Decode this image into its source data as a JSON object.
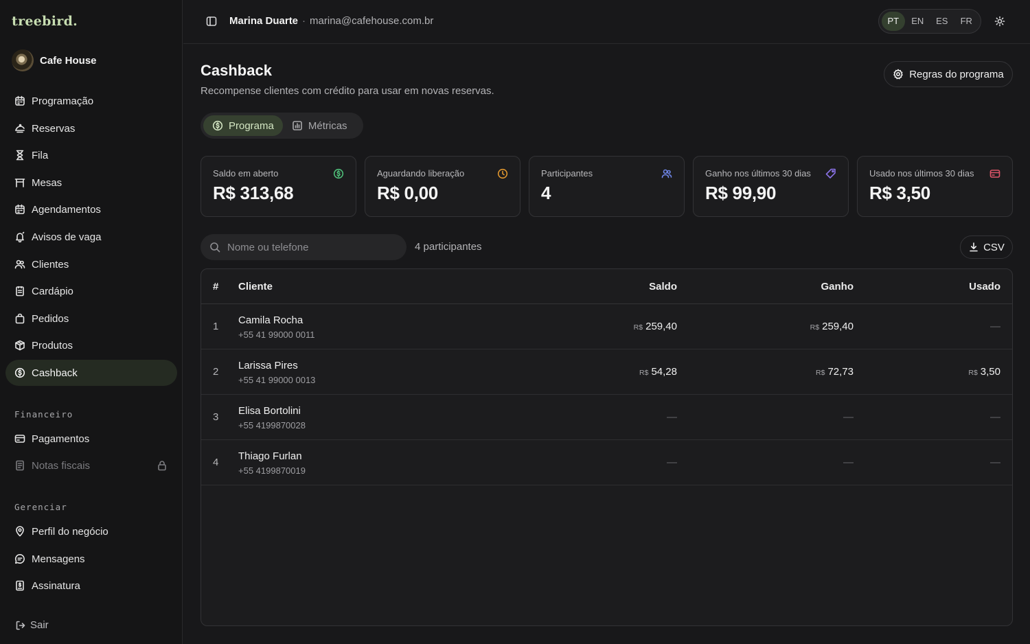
{
  "brand": {
    "logo": "treebird.",
    "business": "Cafe House"
  },
  "sidebar": {
    "items": [
      {
        "label": "Programação",
        "icon": "calendar-icon"
      },
      {
        "label": "Reservas",
        "icon": "reservation-icon"
      },
      {
        "label": "Fila",
        "icon": "hourglass-icon"
      },
      {
        "label": "Mesas",
        "icon": "table-icon"
      },
      {
        "label": "Agendamentos",
        "icon": "calendar-icon"
      },
      {
        "label": "Avisos de vaga",
        "icon": "bell-icon"
      },
      {
        "label": "Clientes",
        "icon": "users-icon"
      },
      {
        "label": "Cardápio",
        "icon": "menu-icon"
      },
      {
        "label": "Pedidos",
        "icon": "bag-icon"
      },
      {
        "label": "Produtos",
        "icon": "package-icon"
      },
      {
        "label": "Cashback",
        "icon": "cashback-icon",
        "active": true
      }
    ],
    "financeiro_title": "Financeiro",
    "financeiro": [
      {
        "label": "Pagamentos",
        "icon": "credit-card-icon"
      },
      {
        "label": "Notas fiscais",
        "icon": "receipt-icon",
        "locked": true
      }
    ],
    "gerenciar_title": "Gerenciar",
    "gerenciar": [
      {
        "label": "Perfil do negócio",
        "icon": "location-pin-icon"
      },
      {
        "label": "Mensagens",
        "icon": "message-icon"
      },
      {
        "label": "Assinatura",
        "icon": "subscription-icon"
      }
    ],
    "logout": "Sair"
  },
  "topbar": {
    "user_name": "Marina Duarte",
    "separator": "·",
    "user_email": "marina@cafehouse.com.br",
    "languages": [
      "PT",
      "EN",
      "ES",
      "FR"
    ],
    "active_language": "PT"
  },
  "page": {
    "title": "Cashback",
    "subtitle": "Recompense clientes com crédito para usar em novas reservas.",
    "rules_button": "Regras do programa",
    "tabs": [
      {
        "label": "Programa",
        "active": true
      },
      {
        "label": "Métricas",
        "active": false
      }
    ]
  },
  "stats": [
    {
      "label": "Saldo em aberto",
      "value": "R$ 313,68",
      "icon": "cashback-icon",
      "color": "#4fbf7a"
    },
    {
      "label": "Aguardando liberação",
      "value": "R$ 0,00",
      "icon": "clock-icon",
      "color": "#e0962e"
    },
    {
      "label": "Participantes",
      "value": "4",
      "icon": "users-icon",
      "color": "#6f86e8"
    },
    {
      "label": "Ganho nos últimos 30 dias",
      "value": "R$ 99,90",
      "icon": "tag-icon",
      "color": "#8a72e6"
    },
    {
      "label": "Usado nos últimos 30 dias",
      "value": "R$ 3,50",
      "icon": "credit-card-icon",
      "color": "#e0566a"
    }
  ],
  "search": {
    "placeholder": "Nome ou telefone",
    "value": ""
  },
  "participants_count": "4 participantes",
  "csv_button": "CSV",
  "table": {
    "columns": [
      "#",
      "Cliente",
      "Saldo",
      "Ganho",
      "Usado"
    ],
    "currency": "R$",
    "empty": "—",
    "rows": [
      {
        "n": "1",
        "name": "Camila Rocha",
        "phone": "+55 41 99000 0011",
        "saldo": "259,40",
        "ganho": "259,40",
        "usado": ""
      },
      {
        "n": "2",
        "name": "Larissa Pires",
        "phone": "+55 41 99000 0013",
        "saldo": "54,28",
        "ganho": "72,73",
        "usado": "3,50"
      },
      {
        "n": "3",
        "name": "Elisa Bortolini",
        "phone": "+55 4199870028",
        "saldo": "",
        "ganho": "",
        "usado": ""
      },
      {
        "n": "4",
        "name": "Thiago Furlan",
        "phone": "+55 4199870019",
        "saldo": "",
        "ganho": "",
        "usado": ""
      }
    ]
  }
}
